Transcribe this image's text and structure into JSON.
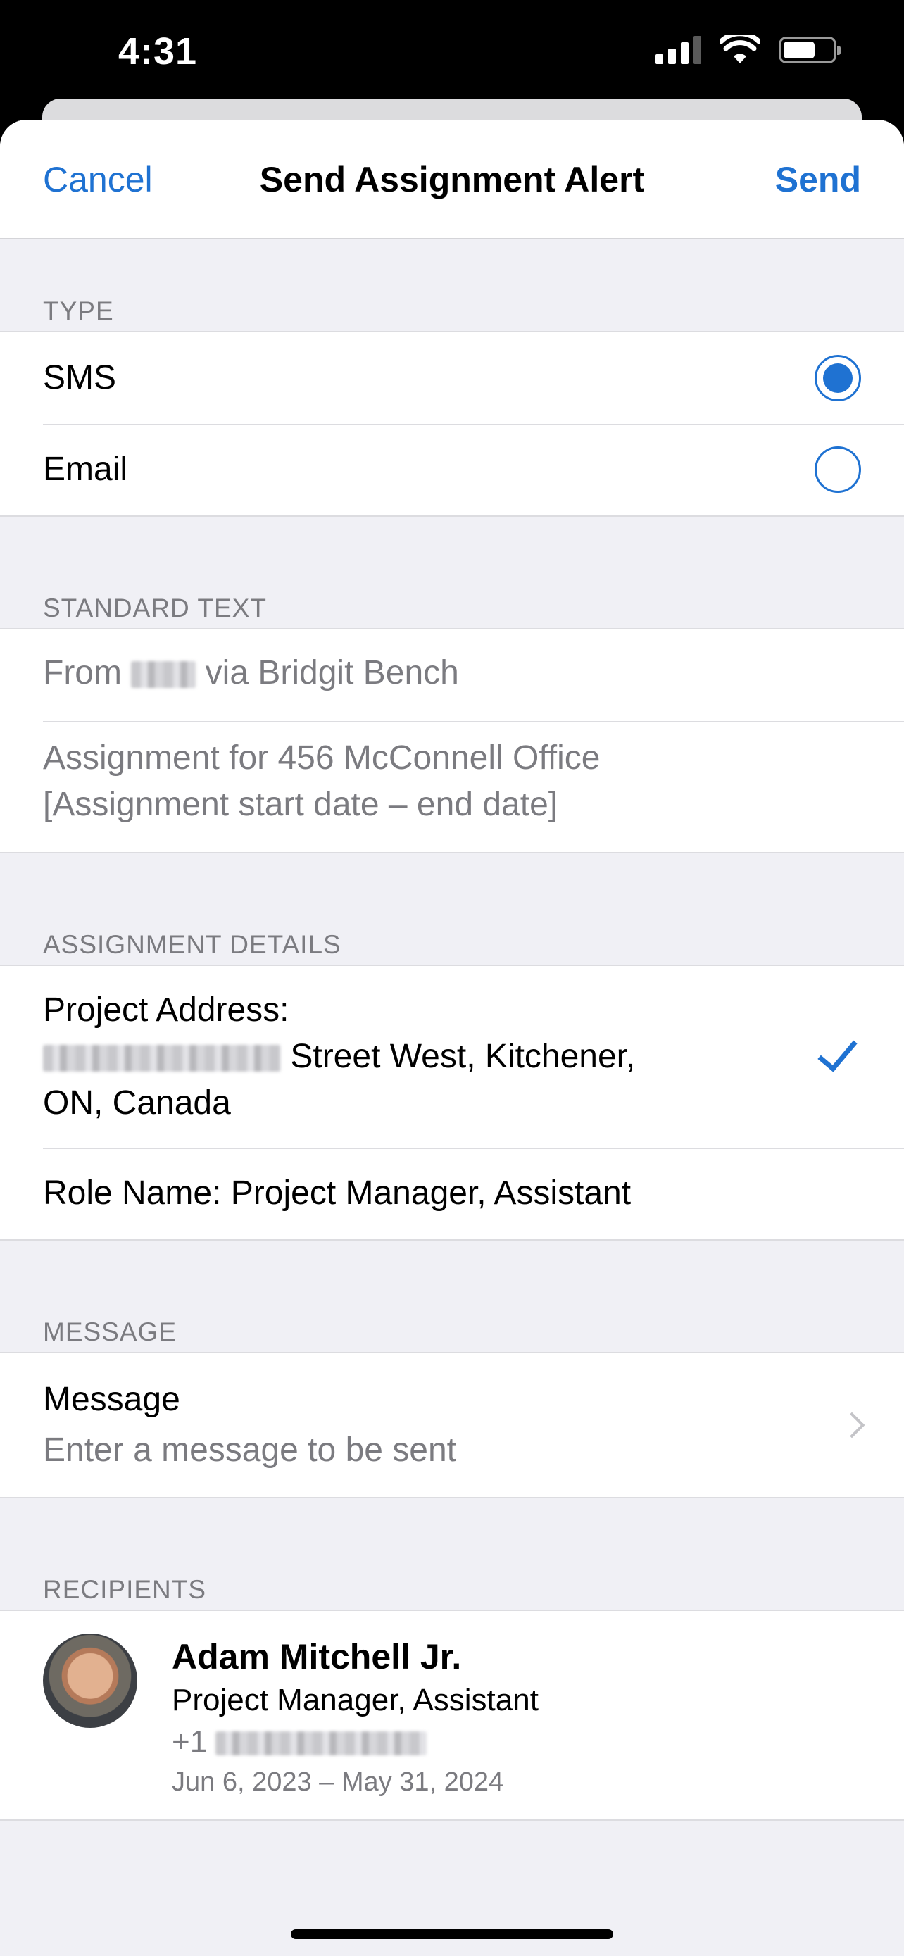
{
  "status_bar": {
    "time": "4:31"
  },
  "nav": {
    "cancel": "Cancel",
    "title": "Send Assignment Alert",
    "send": "Send"
  },
  "type_section": {
    "header": "TYPE",
    "options": [
      {
        "label": "SMS",
        "selected": true
      },
      {
        "label": "Email",
        "selected": false
      }
    ]
  },
  "standard_text": {
    "header": "STANDARD TEXT",
    "from_prefix": "From",
    "from_suffix": "via Bridgit Bench",
    "assignment_line": "Assignment for 456 McConnell Office",
    "date_line": "[Assignment start date – end date]"
  },
  "assignment_details": {
    "header": "ASSIGNMENT DETAILS",
    "address_label": "Project Address:",
    "address_street": "Street West, Kitchener,",
    "address_region": "ON, Canada",
    "role": "Role Name: Project Manager, Assistant"
  },
  "message": {
    "header": "MESSAGE",
    "label": "Message",
    "placeholder": "Enter a message to be sent"
  },
  "recipients": {
    "header": "RECIPIENTS",
    "items": [
      {
        "name": "Adam Mitchell Jr.",
        "role": "Project Manager, Assistant",
        "phone_prefix": "+1",
        "dates": "Jun 6, 2023 – May 31, 2024"
      }
    ]
  },
  "colors": {
    "accent": "#1f72d2",
    "background": "#f0f0f5"
  }
}
